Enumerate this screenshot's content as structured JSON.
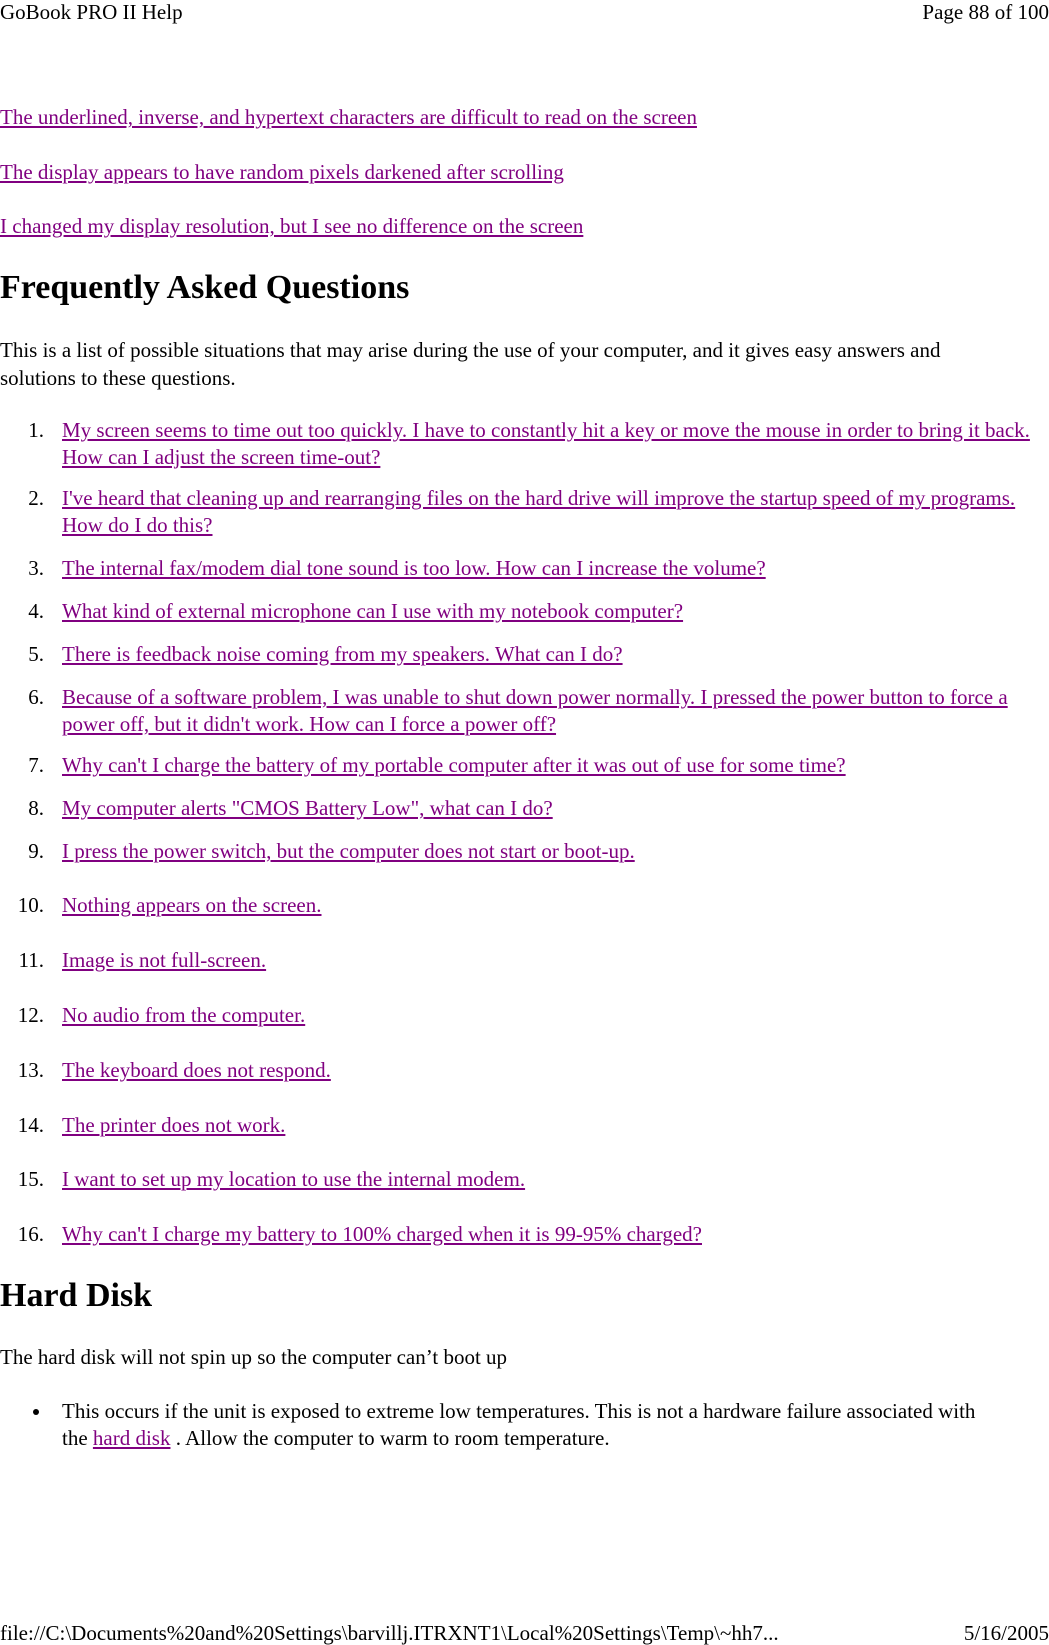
{
  "header": {
    "title": "GoBook PRO II Help",
    "page": "Page 88 of 100"
  },
  "footer": {
    "path": "file://C:\\Documents%20and%20Settings\\barvillj.ITRXNT1\\Local%20Settings\\Temp\\~hh7...",
    "date": "5/16/2005"
  },
  "top_links": [
    "The underlined, inverse, and hypertext characters are difficult to read on the screen",
    "The display appears to have random pixels darkened after scrolling",
    "I changed my display resolution, but I see no difference on the screen"
  ],
  "faq": {
    "heading": "Frequently Asked Questions",
    "intro": "This is a list of possible situations that may arise during the use of your computer, and it gives easy answers and solutions to these questions.",
    "items": [
      {
        "num": "1.",
        "text": "My screen seems to time out too quickly. I have to constantly hit a key or move the mouse in order to bring it back. How can I adjust the screen time-out?"
      },
      {
        "num": "2.",
        "text": "I've heard that cleaning up and rearranging files on the hard drive will improve the startup speed of my programs. How do I do this?"
      },
      {
        "num": "3.",
        "text": "The internal fax/modem dial tone sound is too low. How can I increase the volume?"
      },
      {
        "num": "4.",
        "text": "What kind of external microphone can I use with my notebook computer?"
      },
      {
        "num": "5.",
        "text": "There is feedback noise coming from my speakers. What can I do?"
      },
      {
        "num": "6.",
        "text": "Because of a software problem, I was unable to shut down power normally. I pressed the power button to force a power off, but it didn't work. How can I force a power off?"
      },
      {
        "num": "7.",
        "text": "Why can't I charge the battery of my portable computer after it was out of use for some time?"
      },
      {
        "num": "8.",
        "text": "My computer alerts \"CMOS Battery Low\", what can I do?"
      },
      {
        "num": "9.",
        "text": "I press the power switch, but the computer does not start or boot-up."
      },
      {
        "num": "10.",
        "text": "Nothing appears on the screen."
      },
      {
        "num": "11.",
        "text": "Image is not full-screen."
      },
      {
        "num": "12.",
        "text": "No audio from the computer."
      },
      {
        "num": "13.",
        "text": "The keyboard does not respond."
      },
      {
        "num": "14.",
        "text": "The printer does not work."
      },
      {
        "num": "15.",
        "text": "I want to set up my location to use the internal modem."
      },
      {
        "num": "16.",
        "text": "Why can't I charge my battery to 100% charged when it is 99-95% charged?"
      }
    ]
  },
  "hard_disk": {
    "heading": "Hard Disk",
    "problem": "The hard disk will not spin up so the computer can’t boot up",
    "bullet_before": "This occurs if the unit is exposed to extreme low temperatures. This is not a hardware failure associated with the ",
    "bullet_link": "hard disk",
    "bullet_after": " .  Allow the computer to warm to room temperature."
  },
  "colors": {
    "link": "#800080",
    "text": "#000000",
    "background": "#ffffff"
  }
}
